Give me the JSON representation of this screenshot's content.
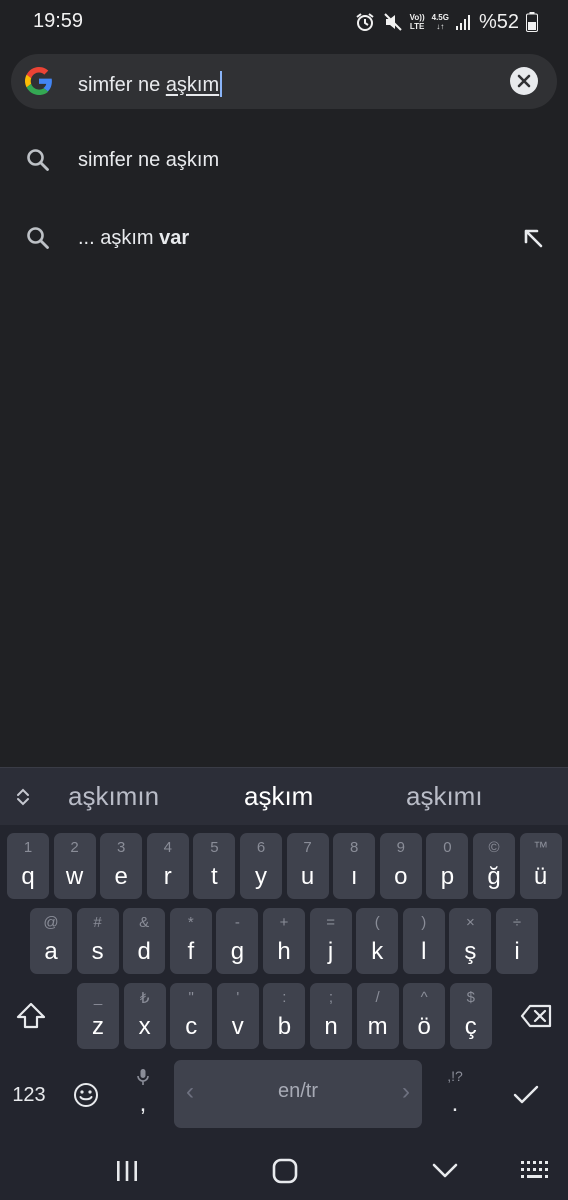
{
  "status_bar": {
    "time": "19:59",
    "network_top": "Vo))",
    "network_bottom": "LTE",
    "data_type": "4.5G",
    "battery": "%52",
    "icons": [
      "alarm-icon",
      "mute-icon",
      "volte-icon",
      "data-arrows-icon",
      "signal-icon",
      "battery-icon"
    ]
  },
  "search": {
    "query_plain": "simfer ne ",
    "query_composing": "aşkım",
    "clear_icon": "close-icon"
  },
  "suggestions": [
    {
      "prefix": "simfer ne aşkım",
      "bold": "",
      "icon": "search-icon",
      "action": ""
    },
    {
      "prefix": "... aşkım ",
      "bold": "var",
      "icon": "search-icon",
      "action": "arrow-up-left-icon"
    }
  ],
  "keyboard": {
    "predictions": [
      "aşkımın",
      "aşkım",
      "aşkımı"
    ],
    "row1": [
      {
        "hint": "1",
        "key": "q"
      },
      {
        "hint": "2",
        "key": "w"
      },
      {
        "hint": "3",
        "key": "e"
      },
      {
        "hint": "4",
        "key": "r"
      },
      {
        "hint": "5",
        "key": "t"
      },
      {
        "hint": "6",
        "key": "y"
      },
      {
        "hint": "7",
        "key": "u"
      },
      {
        "hint": "8",
        "key": "ı"
      },
      {
        "hint": "9",
        "key": "o"
      },
      {
        "hint": "0",
        "key": "p"
      },
      {
        "hint": "©",
        "key": "ğ"
      },
      {
        "hint": "™",
        "key": "ü"
      }
    ],
    "row2": [
      {
        "hint": "@",
        "key": "a"
      },
      {
        "hint": "#",
        "key": "s"
      },
      {
        "hint": "&",
        "key": "d"
      },
      {
        "hint": "*",
        "key": "f"
      },
      {
        "hint": "-",
        "key": "g"
      },
      {
        "hint": "+",
        "key": "h"
      },
      {
        "hint": "=",
        "key": "j"
      },
      {
        "hint": "(",
        "key": "k"
      },
      {
        "hint": ")",
        "key": "l"
      },
      {
        "hint": "×",
        "key": "ş"
      },
      {
        "hint": "÷",
        "key": "i"
      }
    ],
    "row3": [
      {
        "hint": "_",
        "key": "z"
      },
      {
        "hint": "₺",
        "key": "x"
      },
      {
        "hint": "\"",
        "key": "c"
      },
      {
        "hint": "'",
        "key": "v"
      },
      {
        "hint": ":",
        "key": "b"
      },
      {
        "hint": ";",
        "key": "n"
      },
      {
        "hint": "/",
        "key": "m"
      },
      {
        "hint": "^",
        "key": "ö"
      },
      {
        "hint": "$",
        "key": "ç"
      }
    ],
    "symbols_label": "123",
    "comma": ",",
    "period": ".",
    "period_hint": ",!?",
    "space_label": "en/tr",
    "space_arrow_left": "‹",
    "space_arrow_right": "›",
    "accent_color": "#8ab4f8"
  },
  "navbar": {
    "icons": [
      "recents-icon",
      "home-icon",
      "back-icon",
      "keyboard-switch-icon"
    ]
  }
}
